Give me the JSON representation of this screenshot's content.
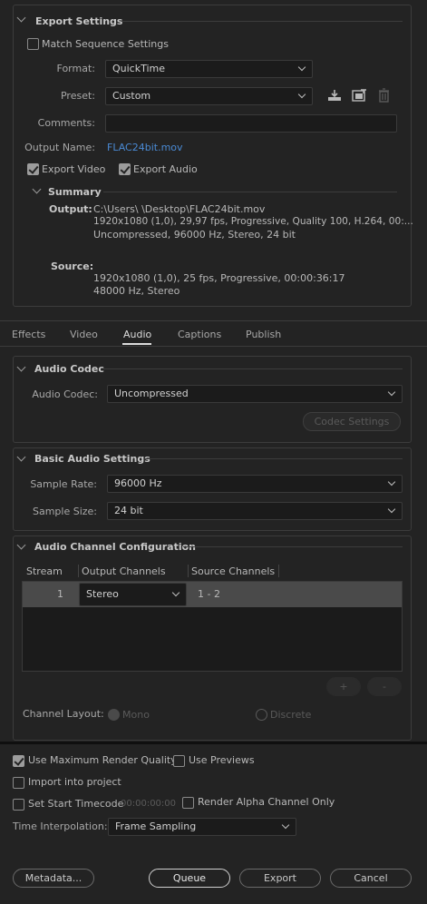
{
  "export_settings": {
    "title": "Export Settings",
    "match_sequence": {
      "label": "Match Sequence Settings",
      "checked": false
    },
    "format": {
      "label": "Format:",
      "value": "QuickTime"
    },
    "preset": {
      "label": "Preset:",
      "value": "Custom"
    },
    "comments": {
      "label": "Comments:",
      "value": ""
    },
    "output_name": {
      "label": "Output Name:",
      "value": "FLAC24bit.mov"
    },
    "export_video": {
      "label": "Export Video",
      "checked": true
    },
    "export_audio": {
      "label": "Export Audio",
      "checked": true
    },
    "summary": {
      "title": "Summary",
      "output_label": "Output:",
      "output_lines": [
        "C:\\Users\\        \\Desktop\\FLAC24bit.mov",
        "1920x1080 (1,0), 29,97 fps, Progressive, Quality 100, H.264, 00:...",
        "Uncompressed, 96000 Hz, Stereo, 24 bit"
      ],
      "source_label": "Source:",
      "source_lines": [
        "1920x1080 (1,0), 25 fps, Progressive, 00:00:36:17",
        "48000 Hz, Stereo"
      ]
    }
  },
  "tabs": [
    {
      "label": "Effects",
      "active": false
    },
    {
      "label": "Video",
      "active": false
    },
    {
      "label": "Audio",
      "active": true
    },
    {
      "label": "Captions",
      "active": false
    },
    {
      "label": "Publish",
      "active": false
    }
  ],
  "audio_codec": {
    "title": "Audio Codec",
    "label": "Audio Codec:",
    "value": "Uncompressed",
    "settings_button": "Codec Settings"
  },
  "basic_audio": {
    "title": "Basic Audio Settings",
    "sample_rate": {
      "label": "Sample Rate:",
      "value": "96000 Hz"
    },
    "sample_size": {
      "label": "Sample Size:",
      "value": "24 bit"
    }
  },
  "channel_config": {
    "title": "Audio Channel Configuration",
    "headers": [
      "Stream",
      "Output Channels",
      "Source Channels"
    ],
    "row": {
      "stream": "1",
      "output": "Stereo",
      "source": "1 - 2"
    },
    "add_label": "+",
    "remove_label": "-",
    "layout_label": "Channel Layout:",
    "mono_label": "Mono",
    "discrete_label": "Discrete"
  },
  "bottom": {
    "max_render": {
      "label": "Use Maximum Render Quality",
      "checked": true
    },
    "use_previews": {
      "label": "Use Previews",
      "checked": false
    },
    "import_project": {
      "label": "Import into project",
      "checked": false
    },
    "start_timecode": {
      "label": "Set Start Timecode",
      "checked": false,
      "value": "00:00:00:00"
    },
    "alpha_only": {
      "label": "Render Alpha Channel Only",
      "checked": false
    },
    "time_interp": {
      "label": "Time Interpolation:",
      "value": "Frame Sampling"
    }
  },
  "buttons": {
    "metadata": "Metadata...",
    "queue": "Queue",
    "export": "Export",
    "cancel": "Cancel"
  },
  "colors": {
    "background": "#232323",
    "link": "#4a8ad4",
    "field": "#1b1b1b"
  }
}
